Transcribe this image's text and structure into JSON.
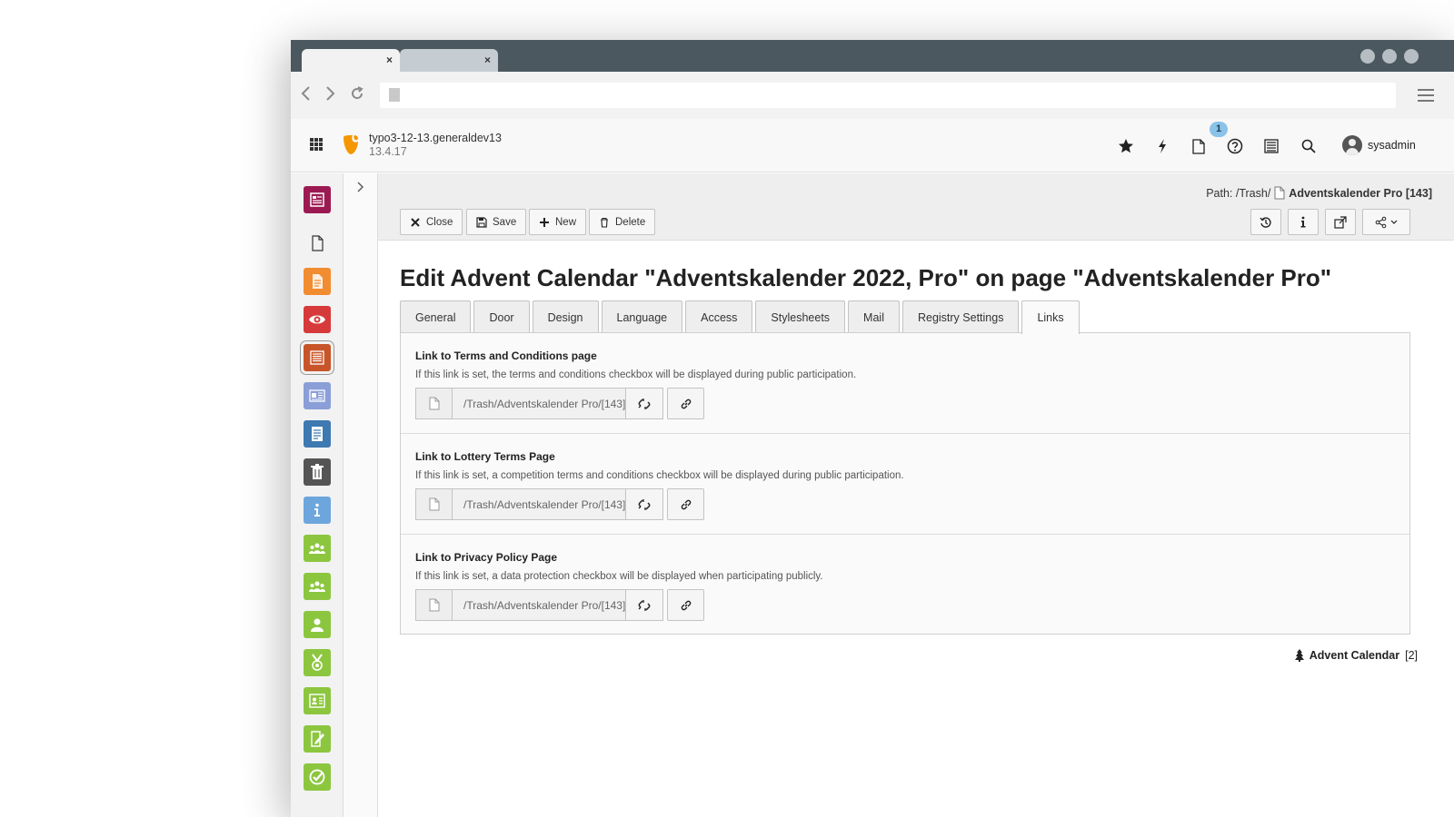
{
  "browser": {
    "tabs": [
      {
        "close": "×"
      },
      {
        "close": "×"
      }
    ]
  },
  "topbar": {
    "site_name": "typo3-12-13.generaldev13",
    "version": "13.4.17",
    "open_docs_badge": "1",
    "username": "sysadmin"
  },
  "docheader": {
    "path_label": "Path: /Trash/",
    "path_page": "Adventskalender Pro [143]",
    "buttons": {
      "close": "Close",
      "save": "Save",
      "new": "New",
      "delete": "Delete"
    }
  },
  "page_title": "Edit Advent Calendar \"Adventskalender 2022, Pro\" on page \"Adventskalender Pro\"",
  "tabs": [
    {
      "label": "General"
    },
    {
      "label": "Door"
    },
    {
      "label": "Design"
    },
    {
      "label": "Language"
    },
    {
      "label": "Access"
    },
    {
      "label": "Stylesheets"
    },
    {
      "label": "Mail"
    },
    {
      "label": "Registry Settings"
    },
    {
      "label": "Links",
      "active": true
    }
  ],
  "fields": [
    {
      "label": "Link to Terms and Conditions page",
      "description": "If this link is set, the terms and conditions checkbox will be displayed during public participation.",
      "value": "/Trash/Adventskalender Pro/[143]"
    },
    {
      "label": "Link to Lottery Terms Page",
      "description": "If this link is set, a competition terms and conditions checkbox will be displayed during public participation.",
      "value": "/Trash/Adventskalender Pro/[143]"
    },
    {
      "label": "Link to Privacy Policy Page",
      "description": "If this link is set, a data protection checkbox will be displayed when participating publicly.",
      "value": "/Trash/Adventskalender Pro/[143]"
    }
  ],
  "record_info": {
    "title": "Advent Calendar",
    "uid": "[2]"
  },
  "colors": {
    "module_icons": [
      "#9c1a52",
      "#ffffff",
      "#f28c31",
      "#d63a3a",
      "#c8552a",
      "#8a9ed8",
      "#3e79b1",
      "#555555",
      "#6da6dc",
      "#8cc63f",
      "#8cc63f",
      "#8cc63f",
      "#8cc63f",
      "#8cc63f",
      "#8cc63f",
      "#8cc63f"
    ]
  }
}
